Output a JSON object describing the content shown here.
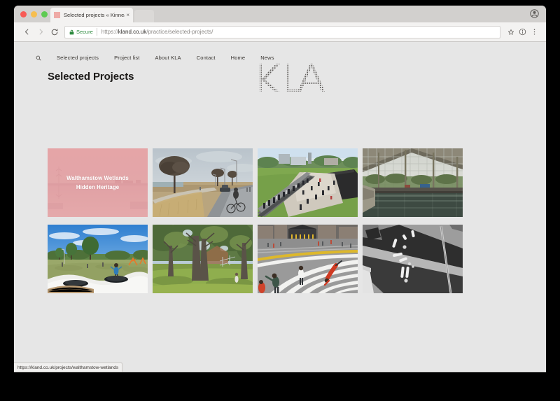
{
  "browser": {
    "tab": {
      "title": "Selected projects « Kinnear L",
      "close_label": "×",
      "favicon_color": "#eeaaa6"
    },
    "toolbar": {
      "back_label": "←",
      "forward_label": "→",
      "reload_label": "C",
      "secure_label": "Secure",
      "url_scheme": "https://",
      "url_domain": "kland.co.uk",
      "url_path": "/practice/selected-projects/",
      "bookmark_label": "☆",
      "info_label": "i",
      "menu_label": "⋮"
    },
    "status_bar": {
      "url": "https://kland.co.uk/projects/walthamstow-wetlands"
    }
  },
  "site": {
    "nav": {
      "search_icon": "search-icon",
      "items": [
        {
          "label": "Selected projects"
        },
        {
          "label": "Project list"
        },
        {
          "label": "About KLA"
        },
        {
          "label": "Contact"
        },
        {
          "label": "Home"
        },
        {
          "label": "News"
        }
      ]
    },
    "header": {
      "title": "Selected Projects",
      "logo_text": "KLA"
    },
    "projects": [
      {
        "name": "walthamstow-wetlands",
        "caption_line1": "Walthamstow Wetlands",
        "caption_line2": "Hidden Heritage",
        "overlay_color": "#e2a1a4",
        "has_caption": true
      },
      {
        "name": "streetscape-cycle-route",
        "has_caption": false
      },
      {
        "name": "campus-plaza-aerial",
        "has_caption": false
      },
      {
        "name": "glasshouse-water-basin",
        "has_caption": false
      },
      {
        "name": "park-trampolines",
        "has_caption": false
      },
      {
        "name": "mature-tree-park",
        "has_caption": false
      },
      {
        "name": "striped-plaza-markings",
        "has_caption": false
      },
      {
        "name": "monochrome-aerial-bands",
        "has_caption": false
      }
    ]
  },
  "colors": {
    "page_background": "#e6e6e6",
    "chrome_toolbar": "#f3f2f1",
    "secure_green": "#2d8a3e",
    "text_dark": "#37332f"
  }
}
